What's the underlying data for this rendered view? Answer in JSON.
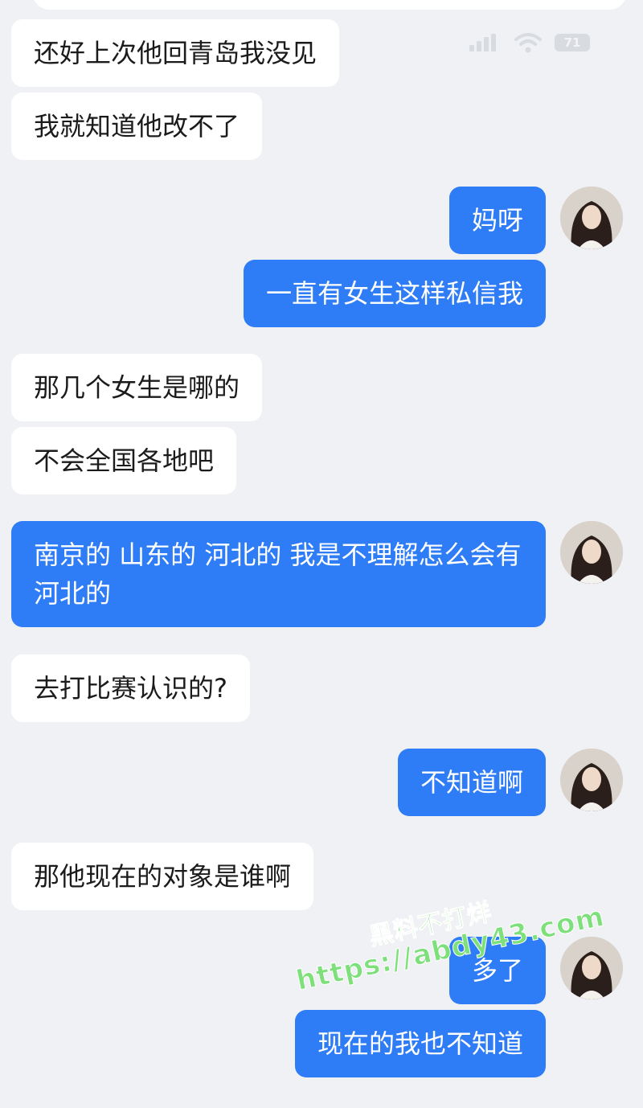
{
  "status_bar": {
    "battery": "71",
    "signal_icon": "signal-icon",
    "wifi_icon": "wifi-icon"
  },
  "messages": [
    {
      "side": "in",
      "text": "还好上次他回青岛我没见"
    },
    {
      "side": "in",
      "text": "我就知道他改不了"
    },
    {
      "side": "out",
      "text": "妈呀"
    },
    {
      "side": "out",
      "text": "一直有女生这样私信我"
    },
    {
      "side": "in",
      "text": "那几个女生是哪的"
    },
    {
      "side": "in",
      "text": "不会全国各地吧"
    },
    {
      "side": "out",
      "text": "南京的 山东的 河北的 我是不理解怎么会有河北的"
    },
    {
      "side": "in",
      "text": "去打比赛认识的?"
    },
    {
      "side": "out",
      "text": "不知道啊"
    },
    {
      "side": "in",
      "text": "那他现在的对象是谁啊"
    },
    {
      "side": "out",
      "text": "多了"
    },
    {
      "side": "out",
      "text": "现在的我也不知道"
    }
  ],
  "watermark": {
    "line1": "黑料不打烊",
    "line2": "https://abdy43.com"
  },
  "colors": {
    "background": "#f0f1f5",
    "incoming_bubble": "#ffffff",
    "outgoing_bubble": "#2e7cf6",
    "watermark": "#7ee07a"
  }
}
